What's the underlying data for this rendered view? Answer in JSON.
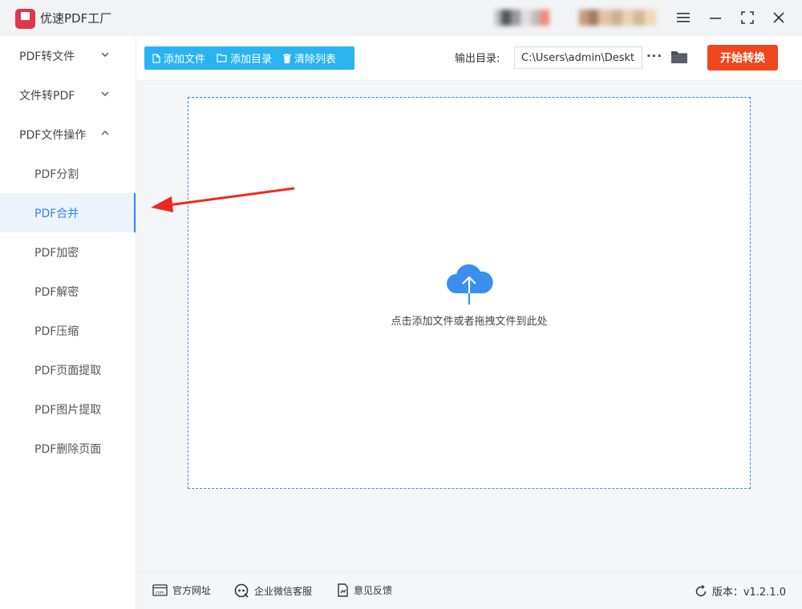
{
  "app": {
    "title": "优速PDF工厂",
    "logo_text": "PDF"
  },
  "window_controls": {
    "menu": "☰",
    "minimize": "—",
    "maximize": "⛶",
    "close": "✕"
  },
  "sidebar": {
    "groups": [
      {
        "label": "PDF转文件",
        "expanded": false
      },
      {
        "label": "文件转PDF",
        "expanded": false
      },
      {
        "label": "PDF文件操作",
        "expanded": true
      }
    ],
    "items": [
      {
        "label": "PDF分割",
        "active": false
      },
      {
        "label": "PDF合并",
        "active": true
      },
      {
        "label": "PDF加密",
        "active": false
      },
      {
        "label": "PDF解密",
        "active": false
      },
      {
        "label": "PDF压缩",
        "active": false
      },
      {
        "label": "PDF页面提取",
        "active": false
      },
      {
        "label": "PDF图片提取",
        "active": false
      },
      {
        "label": "PDF删除页面",
        "active": false
      }
    ]
  },
  "toolbar": {
    "add_file": "添加文件",
    "add_folder": "添加目录",
    "clear_list": "清除列表",
    "output_label": "输出目录:",
    "output_path": "C:\\Users\\admin\\Deskto",
    "more": "···",
    "start": "开始转换"
  },
  "dropzone": {
    "hint": "点击添加文件或者拖拽文件到此处"
  },
  "footer": {
    "website": "官方网址",
    "wechat": "企业微信客服",
    "feedback": "意见反馈",
    "version": "版本：v1.2.1.0"
  },
  "colors": {
    "accent": "#2f86f6",
    "toolbar_btn": "#2ab3f3",
    "start_btn": "#f0461e",
    "logo": "#e2374b"
  }
}
